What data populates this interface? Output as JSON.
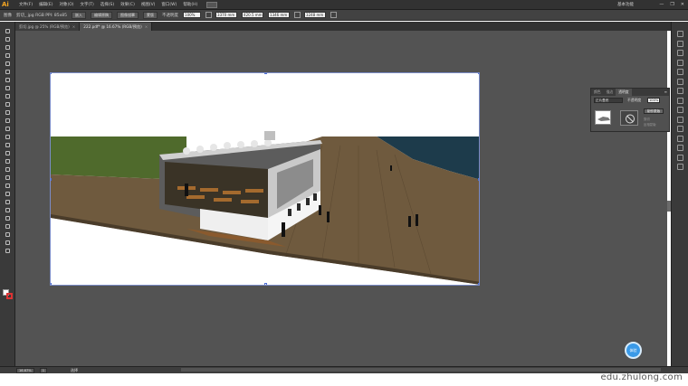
{
  "app": {
    "logo": "Ai",
    "workspace": "基本功能",
    "window_controls": [
      "—",
      "❐",
      "✕"
    ]
  },
  "menu": [
    "文件(F)",
    "编辑(E)",
    "对象(O)",
    "文字(T)",
    "选择(S)",
    "效果(C)",
    "视图(V)",
    "窗口(W)",
    "帮助(H)"
  ],
  "control_bar": {
    "selection": "图像",
    "file_info": "剪切_ jpg  RGB  PPI: 85x85",
    "embed_btn": "嵌入",
    "edit_original_btn": "编辑原稿",
    "image_trace_btn": "图像描摹",
    "mask_btn": "蒙版",
    "opacity_label": "不透明度",
    "opacity_value": "100%",
    "x_value": "3370 mm",
    "y_value": "420.5 mm",
    "w_value": "1346 mm",
    "h_value": "3248 mm"
  },
  "tabs": [
    {
      "label": "剪切.jpg @ 25% (RGB/预览)",
      "active": false
    },
    {
      "label": "222.pdf* @ 16.67% (RGB/预览)",
      "active": true
    }
  ],
  "transparency_panel": {
    "tabs": [
      "颜色",
      "描边",
      "透明度"
    ],
    "active_tab": "透明度",
    "menu_icon": "≡",
    "blend_mode": "正片叠底",
    "opacity_label": "不透明度",
    "opacity_value": "100%",
    "make_mask_btn": "制作蒙版",
    "clip_option": "剪切",
    "invert_option": "反相蒙版"
  },
  "status_bar": {
    "zoom": "16.67%",
    "page": "1",
    "status_text": "选择"
  },
  "fab_label": "体验",
  "watermark": "edu.zhulong.com",
  "colors": {
    "canvas_bg": "#535353",
    "ground": "#6f5a3e",
    "grass": "#4f6a2c",
    "water": "#1d3b4b",
    "selection": "#4a6cd4"
  }
}
